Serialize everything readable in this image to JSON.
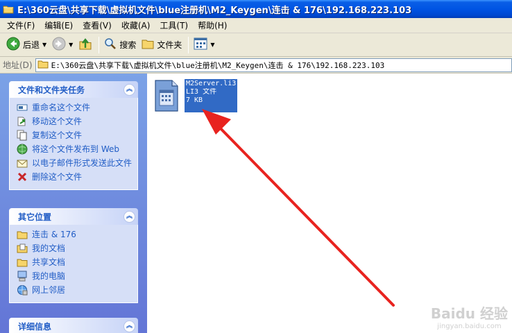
{
  "window": {
    "title": "E:\\360云盘\\共享下载\\虚拟机文件\\blue注册机\\M2_Keygen\\连击 & 176\\192.168.223.103"
  },
  "menu": [
    {
      "label": "文件(F)"
    },
    {
      "label": "编辑(E)"
    },
    {
      "label": "查看(V)"
    },
    {
      "label": "收藏(A)"
    },
    {
      "label": "工具(T)"
    },
    {
      "label": "帮助(H)"
    }
  ],
  "toolbar": {
    "back_label": "后退",
    "search_label": "搜索",
    "folders_label": "文件夹"
  },
  "address": {
    "label": "地址(D)",
    "path": "E:\\360云盘\\共享下载\\虚拟机文件\\blue注册机\\M2_Keygen\\连击 & 176\\192.168.223.103"
  },
  "panels": {
    "tasks": {
      "title": "文件和文件夹任务",
      "items": [
        {
          "label": "重命名这个文件",
          "icon": "rename-icon"
        },
        {
          "label": "移动这个文件",
          "icon": "move-icon"
        },
        {
          "label": "复制这个文件",
          "icon": "copy-icon"
        },
        {
          "label": "将这个文件发布到 Web",
          "icon": "publish-web-icon"
        },
        {
          "label": "以电子邮件形式发送此文件",
          "icon": "email-icon"
        },
        {
          "label": "删除这个文件",
          "icon": "delete-icon"
        }
      ]
    },
    "places": {
      "title": "其它位置",
      "items": [
        {
          "label": "连击 & 176",
          "icon": "folder-icon"
        },
        {
          "label": "我的文档",
          "icon": "my-documents-icon"
        },
        {
          "label": "共享文档",
          "icon": "folder-icon"
        },
        {
          "label": "我的电脑",
          "icon": "my-computer-icon"
        },
        {
          "label": "网上邻居",
          "icon": "network-icon"
        }
      ]
    },
    "details": {
      "title": "详细信息"
    }
  },
  "file": {
    "name": "M2Server.li3",
    "type": "LI3 文件",
    "size": "7 KB",
    "icon": "generic-file-icon"
  },
  "watermark": {
    "line1": "Baidu 经验",
    "line2": "jingyan.baidu.com"
  },
  "colors": {
    "selection": "#316ac5",
    "titlebar": "#0054e3",
    "panel_link": "#215dc6",
    "arrow": "#e8231f"
  }
}
